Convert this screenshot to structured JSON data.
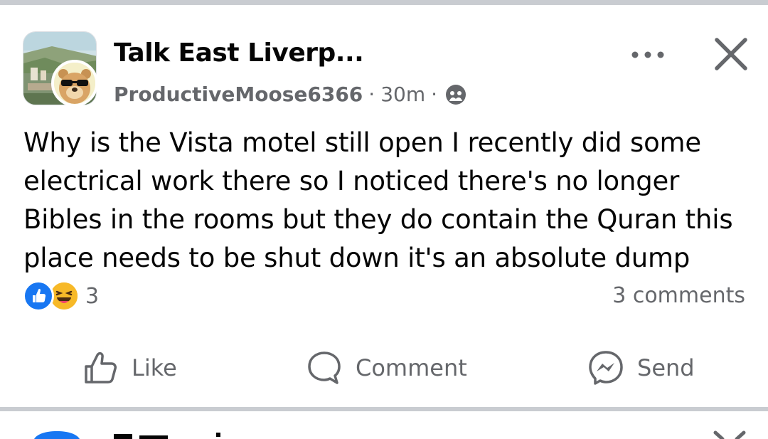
{
  "post": {
    "group_name": "Talk East Liverp...",
    "author": "ProductiveMoose6366",
    "time": "30m",
    "separator": "·",
    "body": "Why is the Vista motel still open I recently did some electrical work there so I noticed there's no longer Bibles in the rooms but they do contain the Quran this place needs to be shut down it's an absolute dump",
    "reaction_count": "3",
    "comments_label": "3 comments",
    "icons": {
      "more": "more-horizontal-icon",
      "close": "close-icon",
      "audience": "public-group-icon"
    }
  },
  "actions": [
    {
      "label": "Like",
      "icon": "thumbs-up-icon"
    },
    {
      "label": "Comment",
      "icon": "comment-bubble-icon"
    },
    {
      "label": "Send",
      "icon": "messenger-icon"
    }
  ],
  "colors": {
    "accent_blue": "#1877f2",
    "haha_yellow": "#f7b928",
    "text_primary": "#050505",
    "text_secondary": "#65676b",
    "divider": "#c9ccd1"
  }
}
